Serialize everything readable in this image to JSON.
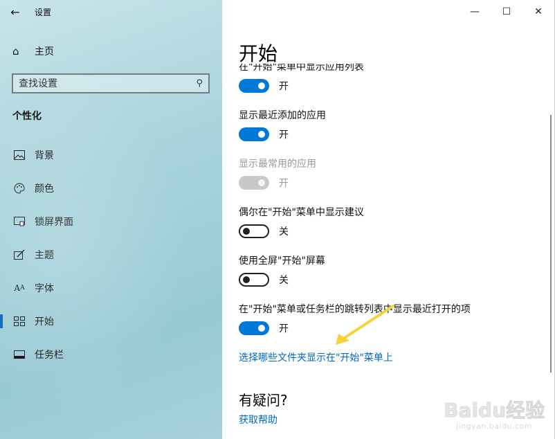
{
  "window": {
    "title": "设置",
    "back_icon": "back-arrow-icon",
    "controls": {
      "minimize": "—",
      "maximize": "☐",
      "close": "✕"
    }
  },
  "sidebar": {
    "home_label": "主页",
    "search_placeholder": "查找设置",
    "section_title": "个性化",
    "items": [
      {
        "label": "背景",
        "icon": "image-icon",
        "active": false
      },
      {
        "label": "颜色",
        "icon": "palette-icon",
        "active": false
      },
      {
        "label": "锁屏界面",
        "icon": "lock-screen-icon",
        "active": false
      },
      {
        "label": "主题",
        "icon": "theme-icon",
        "active": false
      },
      {
        "label": "字体",
        "icon": "font-icon",
        "active": false
      },
      {
        "label": "开始",
        "icon": "start-icon",
        "active": true
      },
      {
        "label": "任务栏",
        "icon": "taskbar-icon",
        "active": false
      }
    ]
  },
  "main": {
    "title": "开始",
    "settings": [
      {
        "label": "在\"开始\"菜单中显示应用列表",
        "state": "开",
        "on": true,
        "disabled": false
      },
      {
        "label": "显示最近添加的应用",
        "state": "开",
        "on": true,
        "disabled": false
      },
      {
        "label": "显示最常用的应用",
        "state": "开",
        "on": true,
        "disabled": true
      },
      {
        "label": "偶尔在\"开始\"菜单中显示建议",
        "state": "关",
        "on": false,
        "disabled": false
      },
      {
        "label": "使用全屏\"开始\"屏幕",
        "state": "关",
        "on": false,
        "disabled": false
      },
      {
        "label": "在\"开始\"菜单或任务栏的跳转列表中显示最近打开的项",
        "state": "开",
        "on": true,
        "disabled": false
      }
    ],
    "folders_link": "选择哪些文件夹显示在\"开始\"菜单上",
    "help_title": "有疑问?",
    "help_link": "获取帮助"
  },
  "colors": {
    "accent": "#0078d7",
    "link": "#0067c0",
    "annotation": "#f5d33a"
  },
  "watermark": {
    "logo": "Baidu经验",
    "sub": "jingyan.baidu.com"
  }
}
